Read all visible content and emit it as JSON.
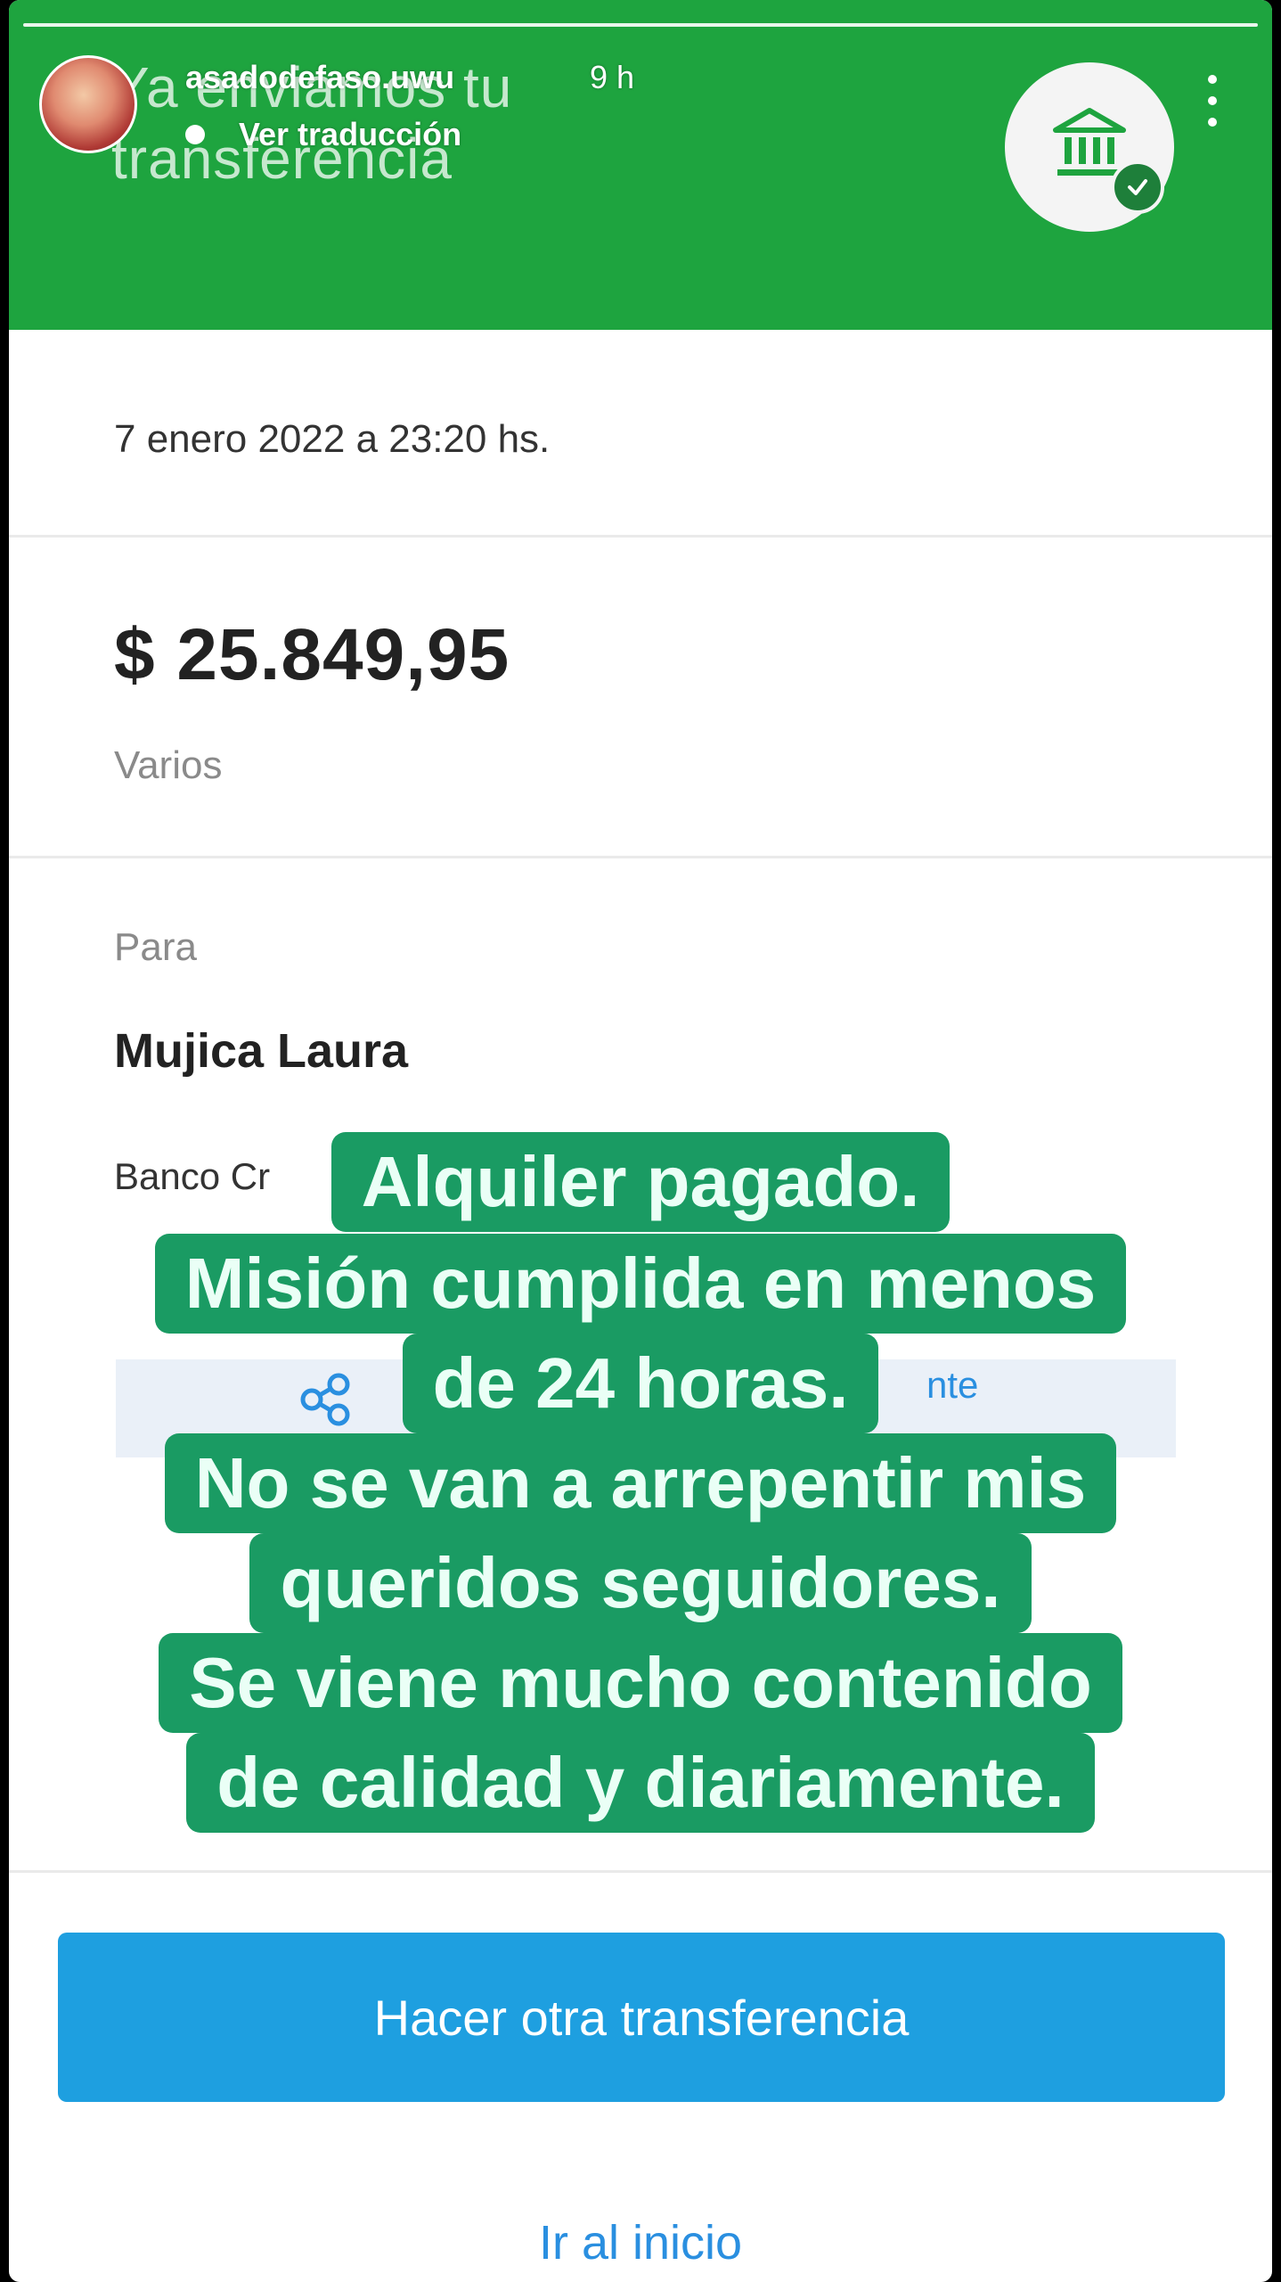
{
  "story": {
    "username": "asadodefaso.uwu",
    "time_ago": "9 h",
    "translate_label": "Ver traducción",
    "more_icon": "more-vertical-icon"
  },
  "header": {
    "title": "Ya enviamos tu transferencia",
    "bank_icon": "bank-icon",
    "check_icon": "check-icon",
    "color": "#1ea43f"
  },
  "transfer": {
    "datetime": "7 enero 2022 a 23:20 hs.",
    "amount": "$ 25.849,95",
    "concept": "Varios",
    "to_label": "Para",
    "recipient": "Mujica Laura",
    "bank_partial": "Banco Cr",
    "share_icon": "share-icon",
    "receipt_partial": "nte"
  },
  "overlay": {
    "lines": [
      "Alquiler pagado.",
      "Misión cumplida en menos",
      "de 24 horas.",
      "No se van a arrepentir mis",
      "queridos seguidores.",
      "Se viene mucho contenido",
      "de calidad y diariamente."
    ],
    "color": "#1a9b63"
  },
  "actions": {
    "primary_label": "Hacer otra transferencia",
    "secondary_label": "Ir al inicio",
    "primary_color": "#1e9fe0"
  }
}
